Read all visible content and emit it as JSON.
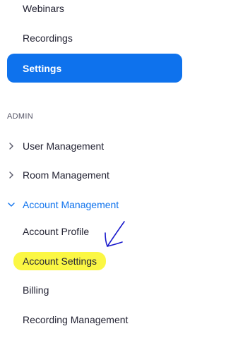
{
  "nav": {
    "webinars": "Webinars",
    "recordings": "Recordings",
    "settings": "Settings"
  },
  "admin": {
    "section_label": "ADMIN",
    "user_management": "User Management",
    "room_management": "Room Management",
    "account_management": "Account Management",
    "account_management_items": {
      "account_profile": "Account Profile",
      "account_settings": "Account Settings",
      "billing": "Billing",
      "recording_management": "Recording Management"
    }
  },
  "colors": {
    "accent": "#0e72ed",
    "highlight": "#fbf73a",
    "annotation": "#1a1acc",
    "text": "#232333"
  },
  "icons": {
    "collapsed": "chevron-right-icon",
    "expanded": "chevron-down-icon",
    "annotation": "hand-drawn-arrow-icon"
  }
}
